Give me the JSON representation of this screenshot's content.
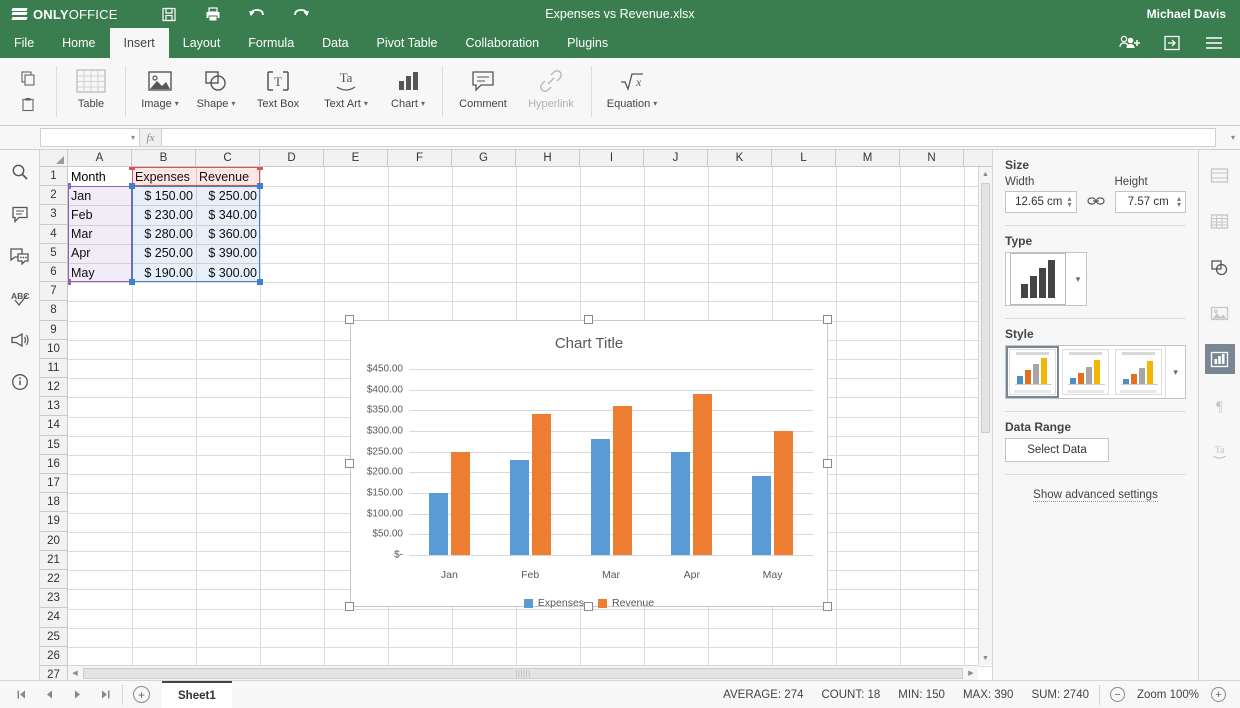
{
  "app": {
    "brand_bold": "ONLY",
    "brand_light": "OFFICE",
    "document_title": "Expenses vs Revenue.xlsx",
    "user_name": "Michael Davis",
    "accent_green": "#3a7d4f"
  },
  "quick_access": [
    {
      "name": "save-icon",
      "title": "Save"
    },
    {
      "name": "print-icon",
      "title": "Print"
    },
    {
      "name": "undo-icon",
      "title": "Undo"
    },
    {
      "name": "redo-icon",
      "title": "Redo"
    }
  ],
  "tabs": [
    {
      "label": "File",
      "active": false
    },
    {
      "label": "Home",
      "active": false
    },
    {
      "label": "Insert",
      "active": true
    },
    {
      "label": "Layout",
      "active": false
    },
    {
      "label": "Formula",
      "active": false
    },
    {
      "label": "Data",
      "active": false
    },
    {
      "label": "Pivot Table",
      "active": false
    },
    {
      "label": "Collaboration",
      "active": false
    },
    {
      "label": "Plugins",
      "active": false
    }
  ],
  "tabbar_icons": [
    {
      "name": "share-user-icon"
    },
    {
      "name": "open-location-icon"
    },
    {
      "name": "hamburger-menu-icon"
    }
  ],
  "ribbon": [
    {
      "label": "Table",
      "icon": "table-icon",
      "caret": false,
      "disabled": false
    },
    {
      "label": "Image",
      "icon": "image-icon",
      "caret": true,
      "disabled": false
    },
    {
      "label": "Shape",
      "icon": "shape-icon",
      "caret": true,
      "disabled": false
    },
    {
      "label": "Text Box",
      "icon": "textbox-icon",
      "caret": false,
      "disabled": false
    },
    {
      "label": "Text Art",
      "icon": "textart-icon",
      "caret": true,
      "disabled": false
    },
    {
      "label": "Chart",
      "icon": "chart-icon",
      "caret": true,
      "disabled": false
    },
    {
      "label": "Comment",
      "icon": "comment-icon",
      "caret": false,
      "disabled": false
    },
    {
      "label": "Hyperlink",
      "icon": "hyperlink-icon",
      "caret": false,
      "disabled": true
    },
    {
      "label": "Equation",
      "icon": "equation-icon",
      "caret": true,
      "disabled": false
    }
  ],
  "clipboard": [
    {
      "name": "copy-icon"
    },
    {
      "name": "paste-icon"
    }
  ],
  "formula_bar": {
    "name_box_value": "",
    "fx_label": "fx",
    "formula_value": ""
  },
  "left_rail": [
    {
      "name": "search-icon"
    },
    {
      "name": "comment-icon"
    },
    {
      "name": "chat-icon"
    },
    {
      "name": "spellcheck-icon"
    },
    {
      "name": "feedback-icon"
    },
    {
      "name": "about-icon"
    }
  ],
  "right_rail": [
    {
      "name": "header-footer-settings-icon",
      "active": false
    },
    {
      "name": "table-settings-icon",
      "active": false
    },
    {
      "name": "shape-settings-icon",
      "active": false
    },
    {
      "name": "image-settings-icon",
      "active": false
    },
    {
      "name": "chart-settings-icon",
      "active": true
    },
    {
      "name": "paragraph-settings-icon",
      "active": false
    },
    {
      "name": "text-art-settings-icon",
      "active": false
    }
  ],
  "sidebar": {
    "size_heading": "Size",
    "width_label": "Width",
    "width_value": "12.65 cm",
    "height_label": "Height",
    "height_value": "7.57 cm",
    "lock_aspect_icon": "link-aspect-ratio-icon",
    "type_heading": "Type",
    "style_heading": "Style",
    "data_range_heading": "Data Range",
    "select_data_label": "Select Data",
    "advanced_label": "Show advanced settings"
  },
  "grid": {
    "columns": [
      "A",
      "B",
      "C",
      "D",
      "E",
      "F",
      "G",
      "H",
      "I",
      "J",
      "K",
      "L",
      "M",
      "N"
    ],
    "rows": [
      1,
      2,
      3,
      4,
      5,
      6,
      7,
      8,
      9,
      10,
      11,
      12,
      13,
      14,
      15,
      16,
      17,
      18,
      19,
      20,
      21,
      22,
      23,
      24,
      25,
      26,
      27
    ],
    "cells": [
      {
        "ref": "A1",
        "col": 0,
        "row": 0,
        "text": "Month",
        "align": "left"
      },
      {
        "ref": "B1",
        "col": 1,
        "row": 0,
        "text": "Expenses",
        "align": "left"
      },
      {
        "ref": "C1",
        "col": 2,
        "row": 0,
        "text": "Revenue",
        "align": "left"
      },
      {
        "ref": "A2",
        "col": 0,
        "row": 1,
        "text": "Jan",
        "align": "left"
      },
      {
        "ref": "B2",
        "col": 1,
        "row": 1,
        "text": "$ 150.00",
        "align": "right"
      },
      {
        "ref": "C2",
        "col": 2,
        "row": 1,
        "text": "$ 250.00",
        "align": "right"
      },
      {
        "ref": "A3",
        "col": 0,
        "row": 2,
        "text": "Feb",
        "align": "left"
      },
      {
        "ref": "B3",
        "col": 1,
        "row": 2,
        "text": "$ 230.00",
        "align": "right"
      },
      {
        "ref": "C3",
        "col": 2,
        "row": 2,
        "text": "$ 340.00",
        "align": "right"
      },
      {
        "ref": "A4",
        "col": 0,
        "row": 3,
        "text": "Mar",
        "align": "left"
      },
      {
        "ref": "B4",
        "col": 1,
        "row": 3,
        "text": "$ 280.00",
        "align": "right"
      },
      {
        "ref": "C4",
        "col": 2,
        "row": 3,
        "text": "$ 360.00",
        "align": "right"
      },
      {
        "ref": "A5",
        "col": 0,
        "row": 4,
        "text": "Apr",
        "align": "left"
      },
      {
        "ref": "B5",
        "col": 1,
        "row": 4,
        "text": "$ 250.00",
        "align": "right"
      },
      {
        "ref": "C5",
        "col": 2,
        "row": 4,
        "text": "$ 390.00",
        "align": "right"
      },
      {
        "ref": "A6",
        "col": 0,
        "row": 5,
        "text": "May",
        "align": "left"
      },
      {
        "ref": "B6",
        "col": 1,
        "row": 5,
        "text": "$ 190.00",
        "align": "right"
      },
      {
        "ref": "C6",
        "col": 2,
        "row": 5,
        "text": "$ 300.00",
        "align": "right"
      }
    ],
    "highlights": [
      {
        "name": "series-names-range",
        "color": "#e05252",
        "col": 1,
        "row": 0,
        "cols": 2,
        "rows": 1
      },
      {
        "name": "categories-range",
        "color": "#8e62b5",
        "col": 0,
        "row": 1,
        "cols": 1,
        "rows": 5
      },
      {
        "name": "values-range",
        "color": "#3f7fd0",
        "col": 1,
        "row": 1,
        "cols": 2,
        "rows": 5
      }
    ]
  },
  "chart_data": {
    "type": "bar",
    "title": "Chart Title",
    "categories": [
      "Jan",
      "Feb",
      "Mar",
      "Apr",
      "May"
    ],
    "series": [
      {
        "name": "Expenses",
        "color": "#5b9bd5",
        "values": [
          150,
          230,
          280,
          250,
          190
        ]
      },
      {
        "name": "Revenue",
        "color": "#ed7d31",
        "values": [
          250,
          340,
          360,
          390,
          300
        ]
      }
    ],
    "ylim": [
      0,
      450
    ],
    "ytick_step": 50,
    "ytick_labels": [
      "$450.00",
      "$400.00",
      "$350.00",
      "$300.00",
      "$250.00",
      "$200.00",
      "$150.00",
      "$100.00",
      "$50.00",
      "$-"
    ],
    "ytick_values": [
      450,
      400,
      350,
      300,
      250,
      200,
      150,
      100,
      50,
      0
    ],
    "xlabel": "",
    "ylabel": "",
    "grid": true,
    "legend_position": "bottom",
    "selected": true
  },
  "status_bar": {
    "nav_first": "first-sheet-icon",
    "nav_prev": "previous-sheet-icon",
    "nav_next": "next-sheet-icon",
    "nav_last": "last-sheet-icon",
    "add_sheet": "+",
    "sheets": [
      {
        "label": "Sheet1",
        "active": true
      }
    ],
    "stats": [
      {
        "label": "AVERAGE: 274"
      },
      {
        "label": "COUNT: 18"
      },
      {
        "label": "MIN: 150"
      },
      {
        "label": "MAX: 390"
      },
      {
        "label": "SUM: 2740"
      }
    ],
    "zoom_out": "−",
    "zoom_label": "Zoom 100%",
    "zoom_in": "+"
  }
}
